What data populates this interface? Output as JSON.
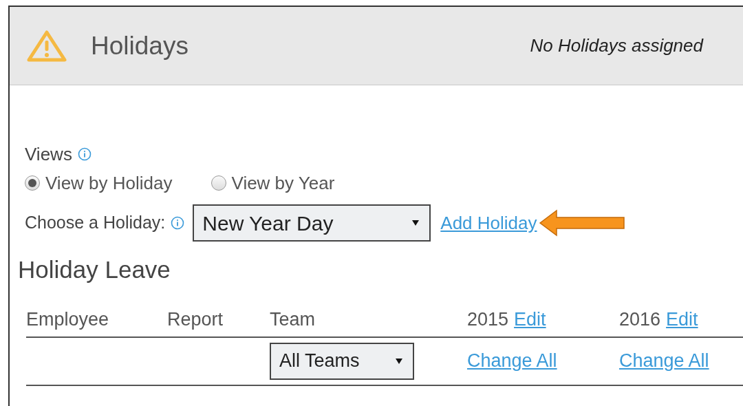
{
  "header": {
    "title": "Holidays",
    "status": "No Holidays assigned"
  },
  "views": {
    "label": "Views",
    "options": [
      {
        "label": "View by Holiday",
        "selected": true
      },
      {
        "label": "View by Year",
        "selected": false
      }
    ]
  },
  "holiday_chooser": {
    "label": "Choose a Holiday:",
    "value": "New Year Day",
    "link": "Add Holiday"
  },
  "section_title": "Holiday Leave",
  "table": {
    "columns": [
      {
        "label": "Employee"
      },
      {
        "label": "Report"
      },
      {
        "label": "Team"
      },
      {
        "label": "2015",
        "link": "Edit"
      },
      {
        "label": "2016",
        "link": "Edit"
      }
    ],
    "filter_row": {
      "team": "All Teams",
      "links": [
        "Change All",
        "Change All"
      ]
    }
  }
}
